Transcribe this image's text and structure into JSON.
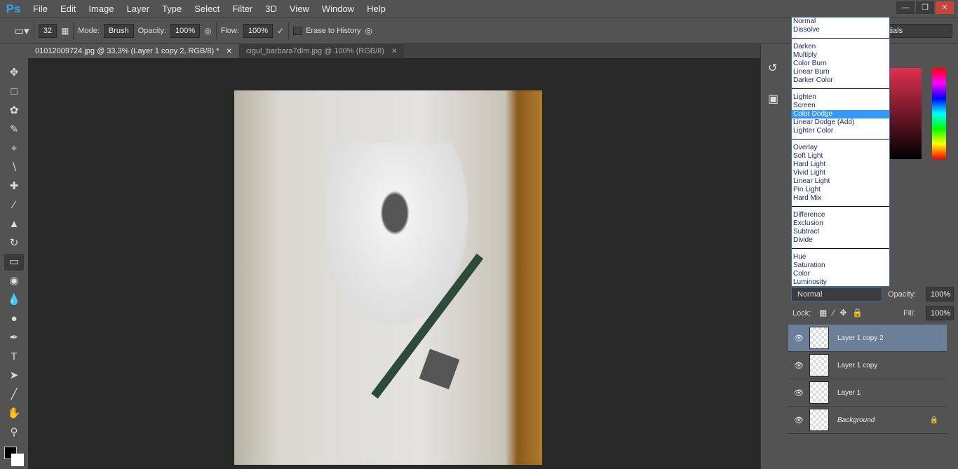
{
  "app": {
    "logo": "Ps"
  },
  "menu": [
    "File",
    "Edit",
    "Image",
    "Layer",
    "Type",
    "Select",
    "Filter",
    "3D",
    "View",
    "Window",
    "Help"
  ],
  "options": {
    "brush_size": "32",
    "mode_label": "Mode:",
    "mode": "Brush",
    "opacity_label": "Opacity:",
    "opacity": "100%",
    "flow_label": "Flow:",
    "flow": "100%",
    "erase_history": "Erase to History",
    "workspace": "Essentials"
  },
  "tabs": [
    {
      "label": "01012009724.jpg @ 33,3% (Layer 1 copy 2, RGB/8) *",
      "active": true
    },
    {
      "label": "cigul_barbara7dlm.jpg @ 100% (RGB/8)",
      "active": false
    }
  ],
  "blend_groups": [
    [
      "Normal",
      "Dissolve"
    ],
    [
      "Darken",
      "Multiply",
      "Color Burn",
      "Linear Burn",
      "Darker Color"
    ],
    [
      "Lighten",
      "Screen",
      "Color Dodge",
      "Linear Dodge (Add)",
      "Lighter Color"
    ],
    [
      "Overlay",
      "Soft Light",
      "Hard Light",
      "Vivid Light",
      "Linear Light",
      "Pin Light",
      "Hard Mix"
    ],
    [
      "Difference",
      "Exclusion",
      "Subtract",
      "Divide"
    ],
    [
      "Hue",
      "Saturation",
      "Color",
      "Luminosity"
    ]
  ],
  "blend_highlighted": "Color Dodge",
  "layers_panel": {
    "blend_mode": "Normal",
    "opacity_label": "Opacity:",
    "opacity": "100%",
    "lock_label": "Lock:",
    "fill_label": "Fill:",
    "fill": "100%"
  },
  "layers": [
    {
      "name": "Layer 1 copy 2",
      "selected": true
    },
    {
      "name": "Layer 1 copy",
      "selected": false
    },
    {
      "name": "Layer 1",
      "selected": false
    },
    {
      "name": "Background",
      "selected": false,
      "locked": true
    }
  ],
  "colors": {
    "accent": "#3399ff",
    "selected_layer": "#6b7f99"
  }
}
